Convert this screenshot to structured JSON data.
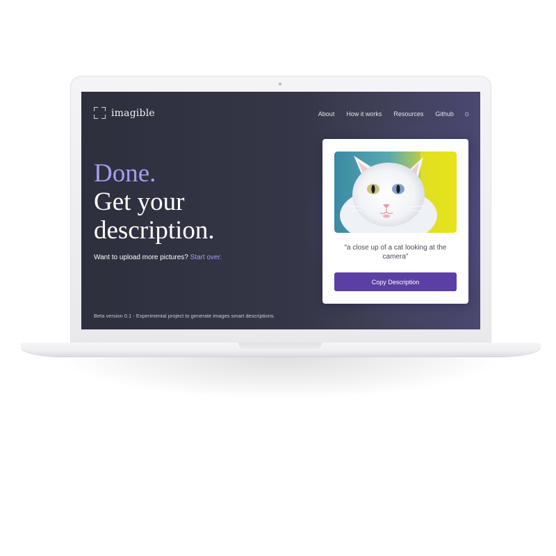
{
  "brand": {
    "name": "imagible"
  },
  "nav": {
    "items": [
      {
        "label": "About"
      },
      {
        "label": "How it works"
      },
      {
        "label": "Resources"
      },
      {
        "label": "Github"
      }
    ],
    "theme_icon": "sun-icon"
  },
  "hero": {
    "accent": "Done.",
    "line1": "Get your",
    "line2": "description."
  },
  "subline": {
    "text": "Want to upload more pictures? ",
    "link": "Start over."
  },
  "result": {
    "image": "white-cat-photo",
    "caption": "\"a close up of a cat looking at the camera\"",
    "copy_button": "Copy Description"
  },
  "footer": {
    "beta": "Beta version 0.1 - Experimental project to generate images smart descriptions."
  },
  "colors": {
    "accent": "#a79cf0",
    "button": "#5b3fa4",
    "screen_bg": "#2d2f3d"
  }
}
